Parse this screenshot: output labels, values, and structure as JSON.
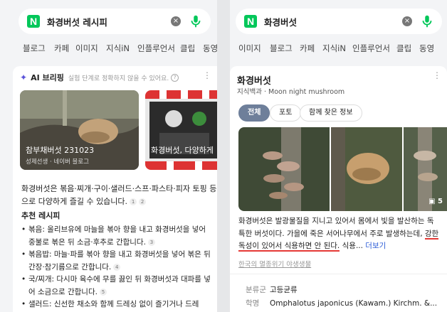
{
  "left": {
    "search": {
      "query": "화경버섯 레시피",
      "clear_icon": "×"
    },
    "tabs": [
      "블로그",
      "카페",
      "이미지",
      "지식iN",
      "인플루언서",
      "클립",
      "동영"
    ],
    "ai": {
      "title": "AI 브리핑",
      "disclaimer": "실험 단계로 정확하지 않을 수 있어요.",
      "help": "?"
    },
    "thumbs": [
      {
        "caption": "참부채버섯 231023",
        "source": "성제선생 · 네이버 블로그"
      },
      {
        "caption": "화경버섯, 다양하게",
        "source": ""
      }
    ],
    "summary": {
      "text": "화경버섯은 볶음·찌개·구이·샐러드·스프·파스타·피자 토핑 등으로 다양하게 즐길 수 있습니다.",
      "refs": [
        "1",
        "2"
      ]
    },
    "recipes_title": "추천 레시피",
    "recipes": [
      {
        "text": "볶음: 올리브유에 마늘을 볶아 향을 내고 화경버섯을 넣어 중불로 볶은 뒤 소금·후추로 간합니다.",
        "ref": "3"
      },
      {
        "text": "볶음밥: 마늘·파를 볶아 향을 내고 화경버섯을 넣어 볶은 뒤 간장·참기름으로 간합니다.",
        "ref": "4"
      },
      {
        "text": "국/찌개: 다시마 육수에 무를 끓인 뒤 화경버섯과 대파를 넣어 소금으로 간합니다.",
        "ref": "5"
      },
      {
        "text": "샐러드: 신선한 채소와 함께 드레싱 없이 즐기거나 드레",
        "ref": ""
      }
    ]
  },
  "right": {
    "search": {
      "query": "화경버섯",
      "clear_icon": "×"
    },
    "tabs": [
      "이미지",
      "블로그",
      "카페",
      "지식iN",
      "인플루언서",
      "클립",
      "동영"
    ],
    "title": "화경버섯",
    "subtitle": "지식백과 · Moon night mushroom",
    "chips": [
      {
        "label": "전체",
        "active": true
      },
      {
        "label": "포토",
        "active": false
      },
      {
        "label": "함께 찾은 정보",
        "active": false
      }
    ],
    "image_count": "5",
    "description": {
      "part1": "화경버섯은 발광물질을 지니고 있어서 몸에서 빛을 발산하는 독특한 버섯이다. 가을에 죽은 서어나무에서 주로 발생하는데, ",
      "highlight": "강한 독성이 있어서 식용하면 안 된다.",
      "part2": " 식용...",
      "more": "더보기"
    },
    "source": "한국의 멸종위기 야생생물",
    "info": [
      {
        "key": "분류군",
        "value": "고등균류"
      },
      {
        "key": "학명",
        "value": "Omphalotus japonicus (Kawam.) Kirchm. &..."
      }
    ]
  }
}
